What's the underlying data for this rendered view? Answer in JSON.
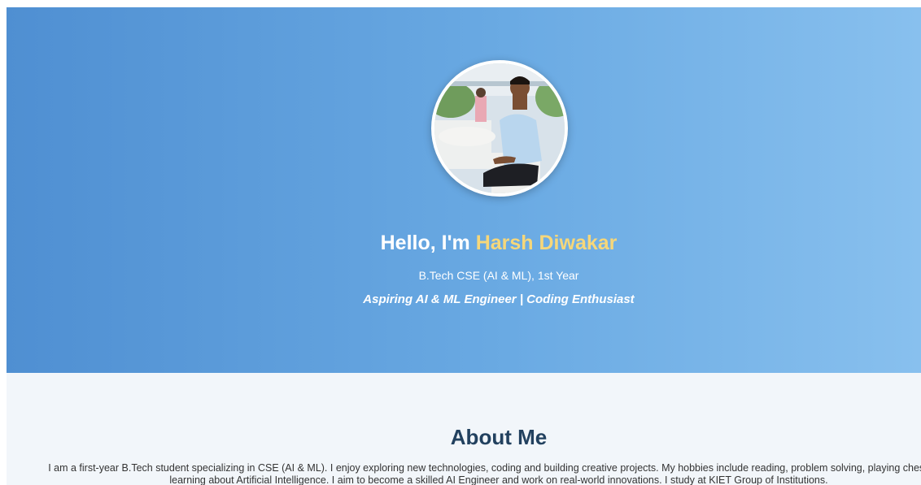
{
  "hero": {
    "greeting": "Hello, I'm ",
    "name": "Harsh Diwakar",
    "subtitle": "B.Tech CSE (AI & ML), 1st Year",
    "tagline": "Aspiring AI & ML Engineer | Coding Enthusiast",
    "avatar_alt": "Profile photo",
    "colors": {
      "gradient_start": "#4f8fd2",
      "gradient_end": "#88c0ee",
      "name_highlight": "#f6d77a"
    }
  },
  "about": {
    "title": "About Me",
    "text": "I am a first-year B.Tech student specializing in CSE (AI & ML). I enjoy exploring new technologies, coding and building creative projects. My hobbies include reading, problem solving, playing chess and learning about Artificial Intelligence. I aim to become a skilled AI Engineer and work on real-world innovations. I study at KIET Group of Institutions.",
    "colors": {
      "background": "#f2f6fa",
      "title": "#22415f"
    }
  }
}
